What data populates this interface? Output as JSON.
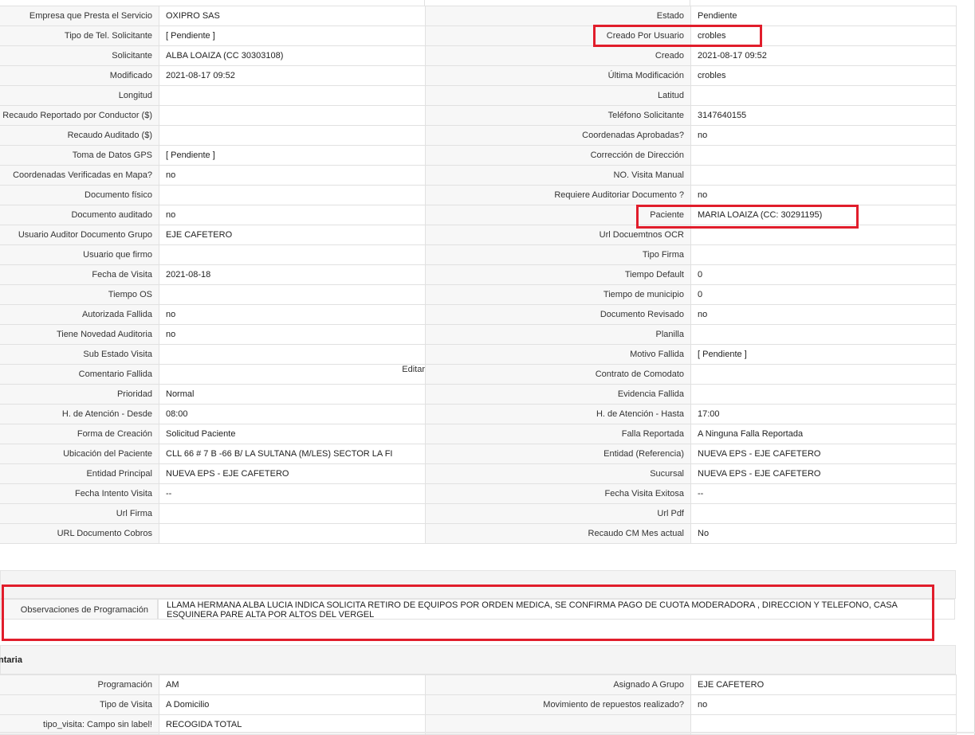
{
  "rows": [
    {
      "l1": "Empresa que Presta el Servicio",
      "v1": "OXIPRO SAS",
      "l2": "Estado",
      "v2": "Pendiente"
    },
    {
      "l1": "Tipo de Tel. Solicitante",
      "v1": "[ Pendiente ]",
      "l2": "Creado Por Usuario",
      "v2": "crobles"
    },
    {
      "l1": "Solicitante",
      "v1": "ALBA LOAIZA (CC 30303108)",
      "l2": "Creado",
      "v2": "2021-08-17 09:52"
    },
    {
      "l1": "Modificado",
      "v1": "2021-08-17 09:52",
      "l2": "Última Modificación",
      "v2": " crobles"
    },
    {
      "l1": "Longitud",
      "v1": "",
      "l2": "Latitud",
      "v2": ""
    },
    {
      "l1": "Recaudo Reportado por Conductor ($)",
      "v1": "",
      "l2": "Teléfono Solicitante",
      "v2": "3147640155"
    },
    {
      "l1": "Recaudo Auditado ($)",
      "v1": "",
      "l2": "Coordenadas Aprobadas?",
      "v2": " no"
    },
    {
      "l1": "Toma de Datos GPS",
      "v1": "[ Pendiente ]",
      "l2": "Corrección de Dirección",
      "v2": ""
    },
    {
      "l1": "Coordenadas Verificadas en Mapa?",
      "v1": " no",
      "l2": "NO. Visita Manual",
      "v2": ""
    },
    {
      "l1": "Documento físico",
      "v1": "",
      "l2": "Requiere Auditoriar Documento ?",
      "v2": " no"
    },
    {
      "l1": "Documento auditado",
      "v1": " no",
      "l2": "Paciente",
      "v2": "MARIA LOAIZA (CC: 30291195)"
    },
    {
      "l1": "Usuario Auditor Documento Grupo",
      "v1": "EJE CAFETERO",
      "l2": "Url Docuemtnos OCR",
      "v2": ""
    },
    {
      "l1": "Usuario que firmo",
      "v1": "",
      "l2": "Tipo Firma",
      "v2": ""
    },
    {
      "l1": "Fecha de Visita",
      "v1": " 2021-08-18",
      "l2": "Tiempo Default",
      "v2": "0"
    },
    {
      "l1": "Tiempo OS",
      "v1": "",
      "l2": "Tiempo de municipio",
      "v2": "0"
    },
    {
      "l1": "Autorizada Fallida",
      "v1": " no",
      "l2": "Documento Revisado",
      "v2": " no"
    },
    {
      "l1": "Tiene Novedad Auditoria",
      "v1": " no",
      "l2": "Planilla",
      "v2": ""
    },
    {
      "l1": "Sub Estado Visita",
      "v1": "",
      "l2": "Motivo Fallida",
      "v2": "[ Pendiente ]"
    },
    {
      "l1": "Comentario Fallida",
      "v1": "",
      "edit": "Editar",
      "l2": "Contrato de Comodato",
      "v2": ""
    },
    {
      "l1": "Prioridad",
      "v1": "Normal",
      "l2": "Evidencia Fallida",
      "v2": ""
    },
    {
      "l1": "H. de Atención - Desde",
      "v1": "08:00",
      "l2": "H. de Atención - Hasta",
      "v2": "17:00"
    },
    {
      "l1": "Forma de Creación",
      "v1": "Solicitud Paciente",
      "l2": "Falla Reportada",
      "v2": "A Ninguna Falla Reportada"
    },
    {
      "l1": "Ubicación del Paciente",
      "v1": "CLL 66 # 7 B -66 B/ LA SULTANA (M/LES) SECTOR LA FI",
      "l2": "Entidad (Referencia)",
      "v2": "NUEVA EPS - EJE CAFETERO"
    },
    {
      "l1": "Entidad Principal",
      "v1": "NUEVA EPS - EJE CAFETERO",
      "l2": "Sucursal",
      "v2": "NUEVA EPS - EJE CAFETERO"
    },
    {
      "l1": "Fecha Intento Visita",
      "v1": " --",
      "l2": "Fecha Visita Exitosa",
      "v2": " --"
    },
    {
      "l1": "Url Firma",
      "v1": "",
      "l2": "Url Pdf",
      "v2": ""
    },
    {
      "l1": "URL Documento Cobros",
      "v1": "",
      "l2": "Recaudo CM Mes actual",
      "v2": "No"
    }
  ],
  "observaciones": {
    "label": "Observaciones de Programación",
    "value": " LLAMA HERMANA ALBA LUCIA INDICA SOLICITA RETIRO DE EQUIPOS POR ORDEN MEDICA, SE CONFIRMA PAGO DE CUOTA MODERADORA , DIRECCION Y TELEFONO, CASA ESQUINERA PARE ALTA POR ALTOS DEL VERGEL"
  },
  "section2": {
    "title": "ntaria",
    "rows": [
      {
        "l1": "Programación",
        "v1": "AM",
        "l2": "Asignado A Grupo",
        "v2": "EJE CAFETERO"
      },
      {
        "l1": "Tipo de Visita",
        "v1": "A Domicilio",
        "l2": "Movimiento de repuestos realizado?",
        "v2": " no"
      },
      {
        "l1": "tipo_visita: Campo sin label!",
        "v1": "RECOGIDA TOTAL",
        "l2": "",
        "v2": ""
      }
    ]
  },
  "highlight_color": "#e11d2b"
}
